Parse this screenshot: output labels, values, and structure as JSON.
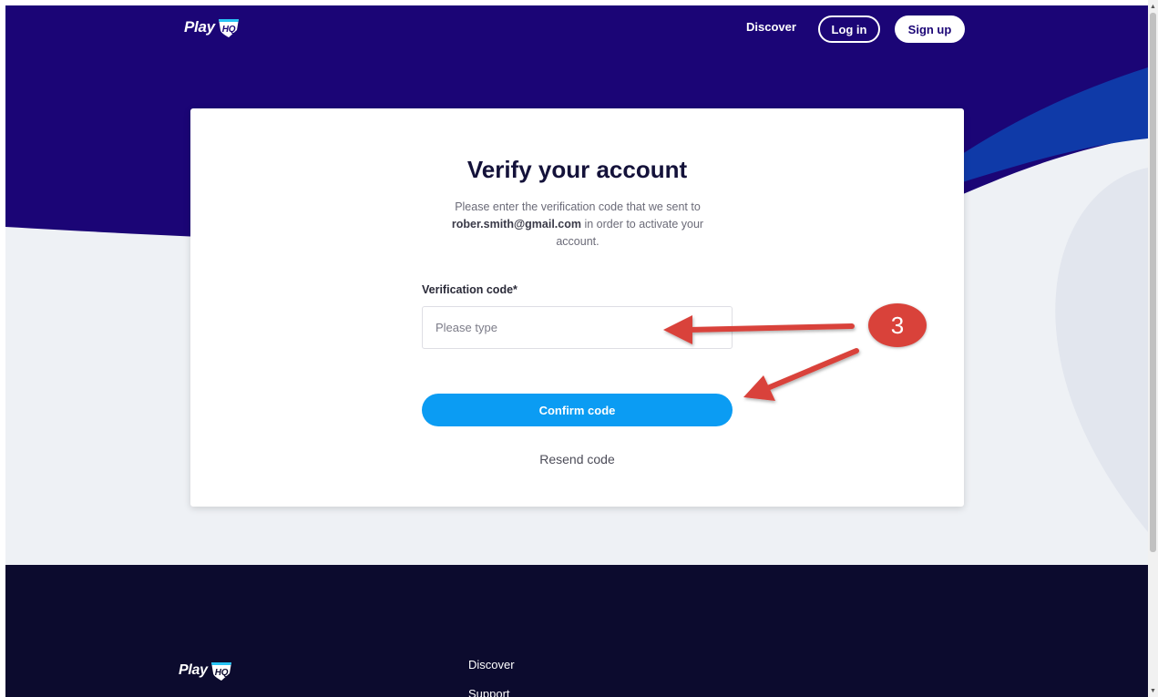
{
  "header": {
    "logo_text": "Play",
    "logo_badge": "HQ",
    "nav": {
      "discover_label": "Discover",
      "login_label": "Log in",
      "signup_label": "Sign up"
    }
  },
  "card": {
    "title": "Verify your account",
    "description_before": "Please enter the verification code that we sent to",
    "email": "rober.smith@gmail.com",
    "description_after": "in order to activate your account.",
    "field_label": "Verification code*",
    "input_value": "",
    "input_placeholder": "Please type",
    "confirm_label": "Confirm code",
    "resend_label": "Resend code"
  },
  "annotation": {
    "step_number": "3"
  },
  "footer": {
    "logo_text": "Play",
    "logo_badge": "HQ",
    "links": [
      "Discover",
      "Support"
    ]
  },
  "colors": {
    "header_bg": "#1b0576",
    "hero_wave_blue": "#0f3aa8",
    "page_bg_light": "#eef1f5",
    "footer_bg": "#0c0b2e",
    "primary_button": "#0b9cf3",
    "annotation_red": "#d9423a"
  },
  "icons": [
    "playhq-shield-icon",
    "scroll-up-arrow-icon",
    "scroll-down-arrow-icon"
  ]
}
